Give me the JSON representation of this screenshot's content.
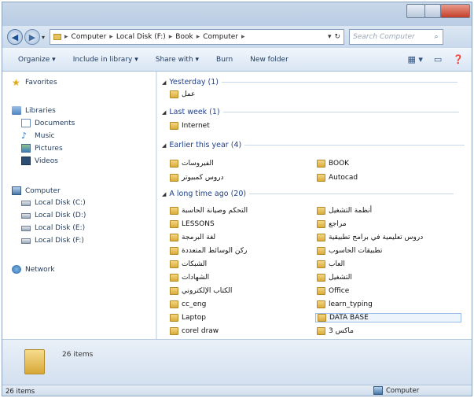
{
  "address": {
    "breadcrumbs": [
      "Computer",
      "Local Disk (F:)",
      "Book",
      "Computer"
    ],
    "search_placeholder": "Search Computer"
  },
  "toolbar": {
    "organize": "Organize ▾",
    "include": "Include in library ▾",
    "share": "Share with ▾",
    "burn": "Burn",
    "new_folder": "New folder"
  },
  "nav": {
    "favorites": "Favorites",
    "libraries": "Libraries",
    "documents": "Documents",
    "music": "Music",
    "pictures": "Pictures",
    "videos": "Videos",
    "computer": "Computer",
    "disk_c": "Local Disk (C:)",
    "disk_d": "Local Disk (D:)",
    "disk_e": "Local Disk (E:)",
    "disk_f": "Local Disk (F:)",
    "network": "Network"
  },
  "groups": {
    "yesterday": "Yesterday (1)",
    "last_week": "Last week (1)",
    "earlier": "Earlier this year (4)",
    "long_ago": "A long time ago (20)"
  },
  "files": {
    "yesterday": [
      "عمل"
    ],
    "last_week": [
      "Internet"
    ],
    "earlier_left": [
      "الفيروسات",
      "دروس كمبيوتر"
    ],
    "earlier_right": [
      "BOOK",
      "Autocad"
    ],
    "long_left": [
      "التحكم وصيانة الحاسبة",
      "LESSONS",
      "لغة البرمجة",
      "ركن الوسائط المتعددة",
      "الشبكات",
      "الشهادات",
      "الكتاب الإلكتروني",
      "cc_eng",
      "Laptop",
      "corel draw"
    ],
    "long_right": [
      "أنظمة التشغيل",
      "مراجع",
      "دروس تعليمية في برامج تطبيقية",
      "تطبيقات الحاسوب",
      "العاب",
      "التشغيل",
      "Office",
      "learn_typing",
      "DATA BASE",
      "ماكس 3"
    ]
  },
  "details": {
    "count": "26 items"
  },
  "status": {
    "count": "26 items",
    "location": "Computer"
  }
}
